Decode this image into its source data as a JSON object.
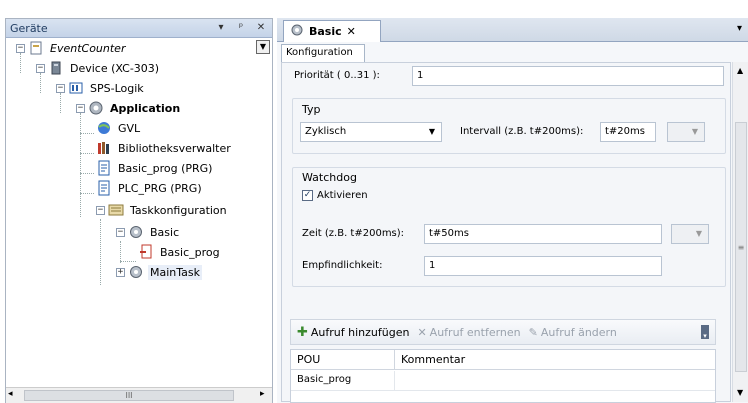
{
  "left_panel": {
    "title": "Geräte",
    "btn_dropdown": "▾",
    "btn_pin": "ᵖ",
    "btn_close": "✕",
    "scroll_grip": "III",
    "tree": [
      {
        "label": "EventCounter",
        "icon": "project-icon",
        "exp": "−"
      },
      {
        "label": "Device (XC-303)",
        "icon": "device-icon",
        "exp": "−"
      },
      {
        "label": "SPS-Logik",
        "icon": "plc-logic-icon",
        "exp": "−"
      },
      {
        "label": "Application",
        "icon": "application-gear-icon",
        "exp": "−"
      },
      {
        "label": "GVL",
        "icon": "globe-icon"
      },
      {
        "label": "Bibliotheksverwalter",
        "icon": "library-icon"
      },
      {
        "label": "Basic_prog (PRG)",
        "icon": "program-icon"
      },
      {
        "label": "PLC_PRG (PRG)",
        "icon": "program-icon"
      },
      {
        "label": "Taskkonfiguration",
        "icon": "task-config-icon",
        "exp": "−"
      },
      {
        "label": "Basic",
        "icon": "task-gear-icon",
        "exp": "−"
      },
      {
        "label": "Basic_prog",
        "icon": "program-call-icon"
      },
      {
        "label": "MainTask",
        "icon": "task-gear-icon",
        "exp": "+"
      }
    ]
  },
  "editor": {
    "tab_label": "Basic",
    "tab_close": "✕",
    "menu_arrow": "▾",
    "subtab": "Konfiguration",
    "prioritaet_label": "Priorität ( 0..31 ):",
    "prioritaet_value": "1",
    "typ_group": "Typ",
    "typ_value": "Zyklisch",
    "intervall_label": "Intervall (z.B. t#200ms):",
    "intervall_value": "t#20ms",
    "watchdog_group": "Watchdog",
    "aktivieren_label": "Aktivieren",
    "aktivieren_checked": true,
    "zeit_label": "Zeit (z.B. t#200ms):",
    "zeit_value": "t#50ms",
    "empf_label": "Empfindlichkeit:",
    "empf_value": "1",
    "toolbar": {
      "add": "Aufruf hinzufügen",
      "remove": "Aufruf entfernen",
      "change": "Aufruf ändern"
    },
    "grid": {
      "columns": [
        "POU",
        "Kommentar"
      ],
      "rows": [
        [
          "Basic_prog",
          ""
        ]
      ]
    },
    "colors": {
      "accent": "#1e3a5f",
      "add_green": "#3a8a2e"
    }
  }
}
